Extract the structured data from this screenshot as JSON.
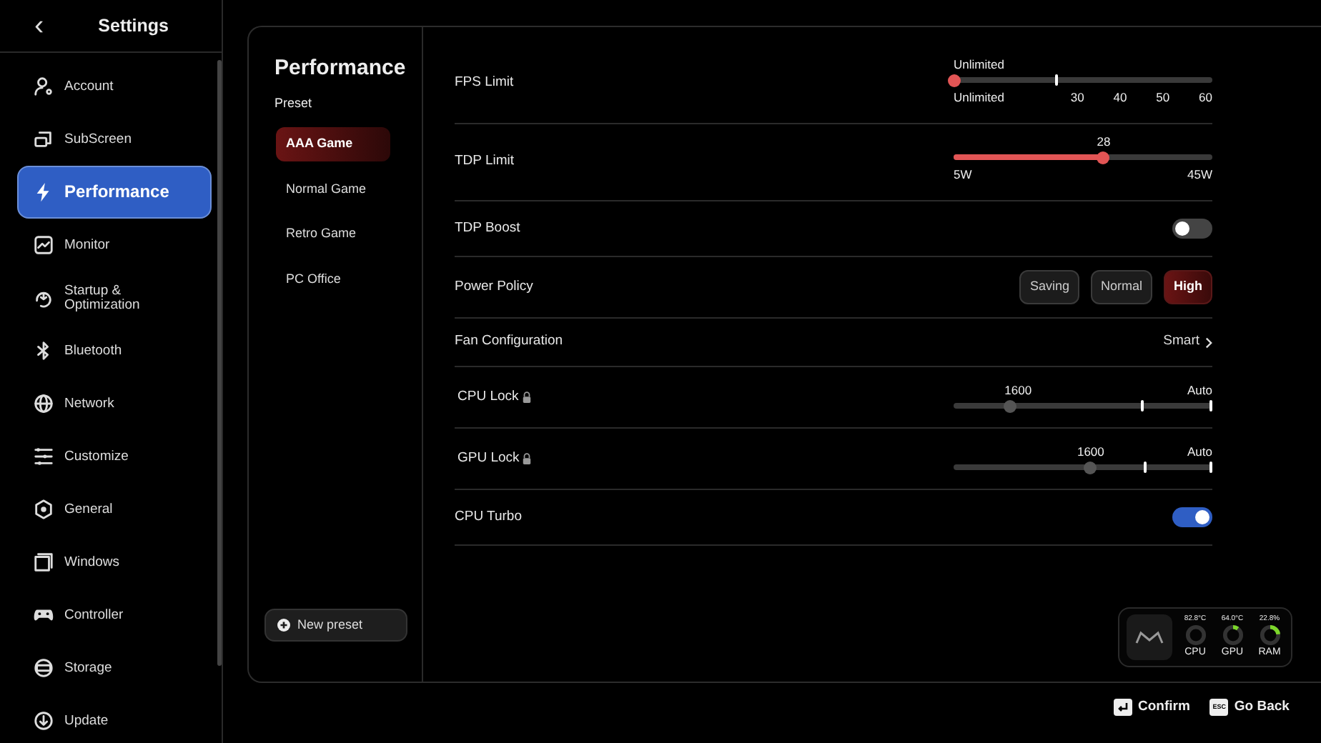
{
  "sidebar": {
    "title": "Settings",
    "back": "‹",
    "items": [
      {
        "label": "Account",
        "selected": false
      },
      {
        "label": "SubScreen",
        "selected": false
      },
      {
        "label": "Performance",
        "selected": true
      },
      {
        "label": "Monitor",
        "selected": false
      },
      {
        "label": "Startup & Optimization",
        "selected": false
      },
      {
        "label": "Bluetooth",
        "selected": false
      },
      {
        "label": "Network",
        "selected": false
      },
      {
        "label": "Customize",
        "selected": false
      },
      {
        "label": "General",
        "selected": false
      },
      {
        "label": "Windows",
        "selected": false
      },
      {
        "label": "Controller",
        "selected": false
      },
      {
        "label": "Storage",
        "selected": false
      },
      {
        "label": "Update",
        "selected": false
      }
    ]
  },
  "presets": {
    "title": "Performance",
    "subtitle": "Preset",
    "items": [
      {
        "label": "AAA Game",
        "selected": true
      },
      {
        "label": "Normal Game",
        "selected": false
      },
      {
        "label": "Retro Game",
        "selected": false
      },
      {
        "label": "PC Office",
        "selected": false
      }
    ],
    "new_button": "New preset"
  },
  "settings": [
    {
      "kind": "steps",
      "label": "FPS Limit",
      "value": "Unlimited",
      "level": 0,
      "scale": [
        "Unlimited",
        "30",
        "40",
        "50",
        "60"
      ]
    },
    {
      "kind": "range",
      "label": "TDP Limit",
      "value": "28",
      "level": 0.58,
      "scale": [
        "5W",
        "45W"
      ]
    },
    {
      "kind": "toggle",
      "label": "TDP Boost",
      "on": false
    },
    {
      "kind": "choice",
      "label": "Power Policy",
      "options": [
        {
          "label": "Saving",
          "selected": false
        },
        {
          "label": "Normal",
          "selected": false
        },
        {
          "label": "High",
          "selected": true
        }
      ]
    },
    {
      "kind": "link",
      "label": "Fan Configuration",
      "value": "Smart"
    },
    {
      "kind": "lock",
      "label": "CPU Lock",
      "value": "1600",
      "end": "Auto",
      "level": 0.22
    },
    {
      "kind": "lock",
      "label": "GPU Lock",
      "value": "1600",
      "end": "Auto",
      "level": 0.53
    },
    {
      "kind": "toggle",
      "label": "CPU Turbo",
      "on": true
    }
  ],
  "monitor": [
    {
      "label": "CPU",
      "reading": "82.8°C"
    },
    {
      "label": "GPU",
      "reading": "64.0°C"
    },
    {
      "label": "RAM",
      "reading": "22.8%"
    }
  ],
  "footer": {
    "confirm": "Confirm",
    "esc_key": "ESC",
    "back": "Go Back"
  }
}
